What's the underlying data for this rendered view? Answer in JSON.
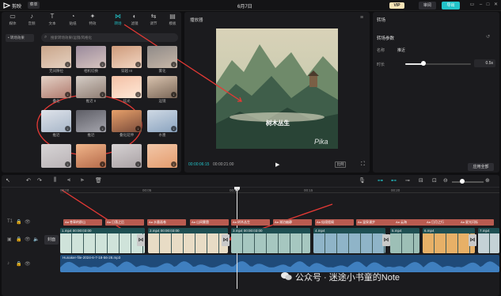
{
  "app": {
    "name": "剪映",
    "menu": "菜单",
    "project_title": "6月7日",
    "vip": "VIP",
    "share": "审阅",
    "export": "导出"
  },
  "tools": [
    {
      "label": "媒体",
      "icon": "media-icon"
    },
    {
      "label": "音频",
      "icon": "audio-icon"
    },
    {
      "label": "文本",
      "icon": "text-icon"
    },
    {
      "label": "贴纸",
      "icon": "sticker-icon"
    },
    {
      "label": "特效",
      "icon": "effects-icon"
    },
    {
      "label": "转场",
      "icon": "transition-icon",
      "active": true
    },
    {
      "label": "滤镜",
      "icon": "filter-icon"
    },
    {
      "label": "调节",
      "icon": "adjust-icon"
    },
    {
      "label": "模板",
      "icon": "template-icon"
    }
  ],
  "left": {
    "category": "• 转场效果",
    "search_placeholder": "搜索转场效果/运镜/风格化",
    "row_labels": [
      "叠化",
      "雾化 II",
      "叠化",
      "运镜拉远",
      "闪光",
      "拉远",
      "叠化",
      "水墨",
      "拉近",
      "推近 IV",
      "冲刺"
    ],
    "thumbs": [
      {
        "label": "无间隙拉",
        "colors": [
          "#c9a58a",
          "#e6d2c2"
        ]
      },
      {
        "label": "相机切换",
        "colors": [
          "#9a8a9c",
          "#d8c5c0"
        ]
      },
      {
        "label": "穿越 III",
        "colors": [
          "#ce9a7a",
          "#f2d7c4"
        ]
      },
      {
        "label": "雾化",
        "colors": [
          "#8f8a88",
          "#c8b8a8"
        ]
      },
      {
        "label": "叠化",
        "colors": [
          "#e4d2c6",
          "#b07a6e"
        ]
      },
      {
        "label": "推近 II",
        "colors": [
          "#d5cdc6",
          "#8f7d73"
        ]
      },
      {
        "label": "炫光",
        "colors": [
          "#f3c0a5",
          "#ffe9d8"
        ]
      },
      {
        "label": "运镜",
        "colors": [
          "#d9c3ae",
          "#7a6758"
        ]
      },
      {
        "label": "推近",
        "colors": [
          "#dfe3ea",
          "#a7b6c8"
        ]
      },
      {
        "label": "推近",
        "colors": [
          "#5e5e66",
          "#a5a5ad"
        ]
      },
      {
        "label": "叠化延伸",
        "colors": [
          "#e7a06a",
          "#7b4c3b"
        ]
      },
      {
        "label": "水墨",
        "colors": [
          "#cfd9e4",
          "#8aa3bf"
        ]
      },
      {
        "label": "",
        "colors": [
          "#d7d5d6",
          "#b9b2b5"
        ]
      },
      {
        "label": "",
        "colors": [
          "#f0b58a",
          "#b56a4a"
        ]
      },
      {
        "label": "",
        "colors": [
          "#d6d2d3",
          "#a9a1a4"
        ]
      },
      {
        "label": "",
        "colors": [
          "#f2c7a8",
          "#e49c6e"
        ]
      }
    ]
  },
  "player": {
    "title": "播放器",
    "subtitle": "树木丛生",
    "watermark": "Pika",
    "current_time": "00:00:06:15",
    "total_time": "00:00:21:00",
    "ratio": "比例"
  },
  "right": {
    "tab": "转场",
    "section": "转场参数",
    "name_label": "名称",
    "name_value": "推近",
    "duration_label": "时长",
    "duration_value": "0.5s",
    "duration_fraction": 0.28,
    "apply_all": "应用全部"
  },
  "timeline": {
    "ruler": [
      "00:00",
      "00:05",
      "00:10",
      "00:15",
      "00:20"
    ],
    "cover": "封面",
    "subtitles": [
      "Aa 苍翠的群山",
      "Aa 日落之后",
      "Aa 水墨画卷",
      "Aa 山间雾霭",
      "Aa 树木丛生",
      "Aa 湖泊幽静",
      "Aa 仙境楼阁",
      "Aa 温泉漫步",
      "Aa 云海",
      "Aa 日月之行",
      "Aa 星光闪烁"
    ],
    "clips": [
      {
        "name": "1.mp4  00:00:03:00",
        "color": "#cfe3da"
      },
      {
        "name": "2.mp4  00:00:03:00",
        "color": "#e8dcc5"
      },
      {
        "name": "3.mp4  00:00:03:00",
        "color": "#a6c7c0"
      },
      {
        "name": "4.mp4",
        "color": "#8fb4c8"
      },
      {
        "name": "5.mp4",
        "color": "#9dbfb6"
      },
      {
        "name": "6.mp4",
        "color": "#e7b067"
      },
      {
        "name": "7.mp4",
        "color": "#c4d2d6"
      }
    ],
    "audio_name": "Hunaker-file-2024-6-7-18-56-28.mp3"
  },
  "overlay_watermark": "公众号 · 迷途小书童的Note"
}
